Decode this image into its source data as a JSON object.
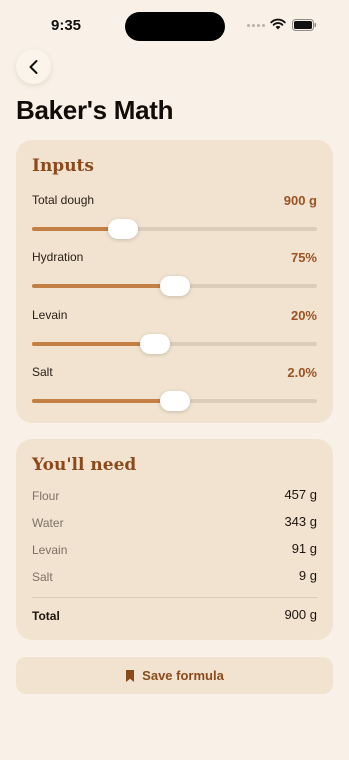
{
  "status_bar": {
    "time": "9:35"
  },
  "header": {
    "title": "Baker's Math",
    "back_icon": "chevron-left-icon"
  },
  "inputs": {
    "title": "Inputs",
    "items": [
      {
        "label": "Total dough",
        "value": "900 g",
        "level": 0.32
      },
      {
        "label": "Hydration",
        "value": "75%",
        "level": 0.5
      },
      {
        "label": "Levain",
        "value": "20%",
        "level": 0.43
      },
      {
        "label": "Salt",
        "value": "2.0%",
        "level": 0.5
      }
    ]
  },
  "need": {
    "title": "You'll need",
    "items": [
      {
        "label": "Flour",
        "value": "457 g"
      },
      {
        "label": "Water",
        "value": "343 g"
      },
      {
        "label": "Levain",
        "value": "91 g"
      },
      {
        "label": "Salt",
        "value": "9 g"
      }
    ],
    "total": {
      "label": "Total",
      "value": "900 g"
    }
  },
  "save_button": {
    "label": "Save formula",
    "icon": "bookmark-icon"
  },
  "colors": {
    "background": "#f9f1e7",
    "card": "#f1e3cf",
    "accent": "#8b4a1c",
    "slider_fill": "#c47f45"
  }
}
